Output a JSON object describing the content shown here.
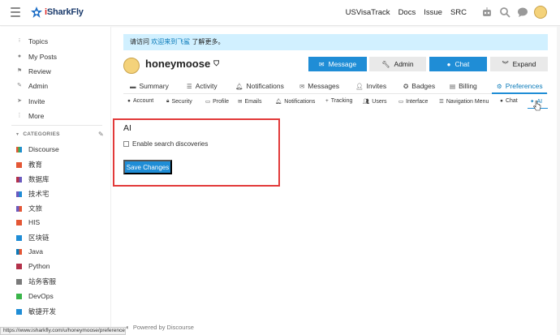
{
  "header": {
    "logo_text_1": "i",
    "logo_text_2": "SharkFly",
    "links": [
      "USVisaTrack",
      "Docs",
      "Issue",
      "SRC"
    ],
    "icons": [
      "robot-icon",
      "search-icon",
      "chat-bubble-icon",
      "user-avatar"
    ]
  },
  "sidebar": {
    "items": [
      {
        "label": "Topics",
        "icon": "topics-icon"
      },
      {
        "label": "My Posts",
        "icon": "user-icon"
      },
      {
        "label": "Review",
        "icon": "flag-icon"
      },
      {
        "label": "Admin",
        "icon": "wrench-icon"
      },
      {
        "label": "Invite",
        "icon": "paper-plane-icon"
      },
      {
        "label": "More",
        "icon": "ellipsis-icon"
      }
    ],
    "categories_header": "CATEGORIES",
    "categories": [
      {
        "label": "Discourse",
        "color": "#e45735"
      },
      {
        "label": "教育",
        "color": "#e45735"
      },
      {
        "label": "数据库",
        "color": "#b3324a"
      },
      {
        "label": "技术宅",
        "color": "#6b5bbf"
      },
      {
        "label": "文旅",
        "color": "#6b5bbf"
      },
      {
        "label": "HIS",
        "color": "#e45735"
      },
      {
        "label": "区块链",
        "color": "#1f8dd6"
      },
      {
        "label": "Java",
        "color": "#0a7ab9"
      },
      {
        "label": "Python",
        "color": "#b3324a"
      },
      {
        "label": "站务客服",
        "color": "#7a7a7a"
      },
      {
        "label": "DevOps",
        "color": "#3ab54a"
      },
      {
        "label": "敏捷开发",
        "color": "#1f8dd6"
      }
    ]
  },
  "statusbar": {
    "url": "https://www.isharkfly.com/u/honeymoose/preferences/ai"
  },
  "notice": {
    "prefix": "请访问 ",
    "link": "欢迎来到飞鲨",
    "suffix": " 了解更多。"
  },
  "profile": {
    "username": "honeymoose",
    "buttons": [
      {
        "label": "Message",
        "icon": "envelope-icon"
      },
      {
        "label": "Admin",
        "icon": "wrench-icon"
      },
      {
        "label": "Chat",
        "icon": "chat-icon"
      },
      {
        "label": "Expand",
        "icon": "double-chevron-icon"
      }
    ]
  },
  "tabs": [
    {
      "label": "Summary",
      "icon": "summary-icon"
    },
    {
      "label": "Activity",
      "icon": "list-icon"
    },
    {
      "label": "Notifications",
      "icon": "bell-icon"
    },
    {
      "label": "Messages",
      "icon": "envelope-icon"
    },
    {
      "label": "Invites",
      "icon": "user-plus-icon"
    },
    {
      "label": "Badges",
      "icon": "badge-icon"
    },
    {
      "label": "Billing",
      "icon": "billing-icon"
    },
    {
      "label": "Preferences",
      "icon": "gear-icon"
    }
  ],
  "subtabs": [
    {
      "label": "Account",
      "icon": "account-icon"
    },
    {
      "label": "Security",
      "icon": "lock-icon"
    },
    {
      "label": "Profile",
      "icon": "id-card-icon"
    },
    {
      "label": "Emails",
      "icon": "envelope-icon"
    },
    {
      "label": "Notifications",
      "icon": "bell-icon"
    },
    {
      "label": "Tracking",
      "icon": "plus-icon"
    },
    {
      "label": "Users",
      "icon": "users-icon"
    },
    {
      "label": "Interface",
      "icon": "desktop-icon"
    },
    {
      "label": "Navigation Menu",
      "icon": "bars-icon"
    },
    {
      "label": "Chat",
      "icon": "chat-icon"
    },
    {
      "label": "AI",
      "icon": "sparkle-icon"
    }
  ],
  "ai_section": {
    "title": "AI",
    "checkbox_label": "Enable search discoveries",
    "save_label": "Save Changes"
  },
  "footer": {
    "powered": "Powered by Discourse"
  }
}
